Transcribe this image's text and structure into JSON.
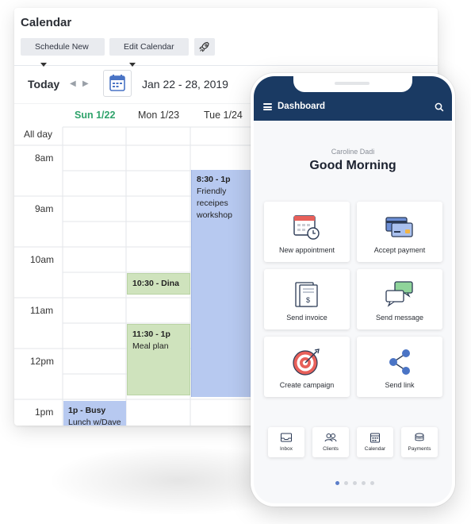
{
  "calendar": {
    "title": "Calendar",
    "toolbar": {
      "schedule_new": "Schedule New",
      "edit_calendar": "Edit Calendar"
    },
    "nav": {
      "today": "Today",
      "prev_symbol": "◀",
      "next_symbol": "▶",
      "date_range": "Jan 22 - 28, 2019"
    },
    "days": [
      "Sun 1/22",
      "Mon 1/23",
      "Tue 1/24"
    ],
    "all_day_label": "All day",
    "hours": [
      "8am",
      "9am",
      "10am",
      "11am",
      "12pm",
      "1pm"
    ],
    "events": [
      {
        "time": "8:30 - 1p",
        "title_lines": [
          "Friendly",
          "receipes",
          "workshop"
        ],
        "color": "#b7c9f0"
      },
      {
        "time": "10:30 - Dina",
        "title_lines": [],
        "color": "#cfe3bd"
      },
      {
        "time": "11:30 - 1p",
        "title_lines": [
          "Meal plan"
        ],
        "color": "#cfe3bd"
      },
      {
        "time": "1p - Busy",
        "title_lines": [
          "Lunch w/Dave"
        ],
        "color": "#b7c9f0"
      }
    ],
    "today_color": "#2fa36b"
  },
  "phone": {
    "title": "Dashboard",
    "user_name": "Caroline Dadi",
    "greeting": "Good Morning",
    "tiles": [
      {
        "label": "New appointment",
        "icon": "calendar-clock-icon"
      },
      {
        "label": "Accept payment",
        "icon": "credit-cards-icon"
      },
      {
        "label": "Send invoice",
        "icon": "invoice-icon"
      },
      {
        "label": "Send message",
        "icon": "chat-bubbles-icon"
      },
      {
        "label": "Create campaign",
        "icon": "target-icon"
      },
      {
        "label": "Send link",
        "icon": "share-icon"
      }
    ],
    "bottom_nav": [
      {
        "label": "Inbox",
        "icon": "inbox-icon"
      },
      {
        "label": "Clients",
        "icon": "clients-icon"
      },
      {
        "label": "Calendar",
        "icon": "calendar-icon"
      },
      {
        "label": "Payments",
        "icon": "payments-icon"
      }
    ],
    "page_dots": {
      "count": 5,
      "active_index": 0
    },
    "header_color": "#1a3a63"
  }
}
